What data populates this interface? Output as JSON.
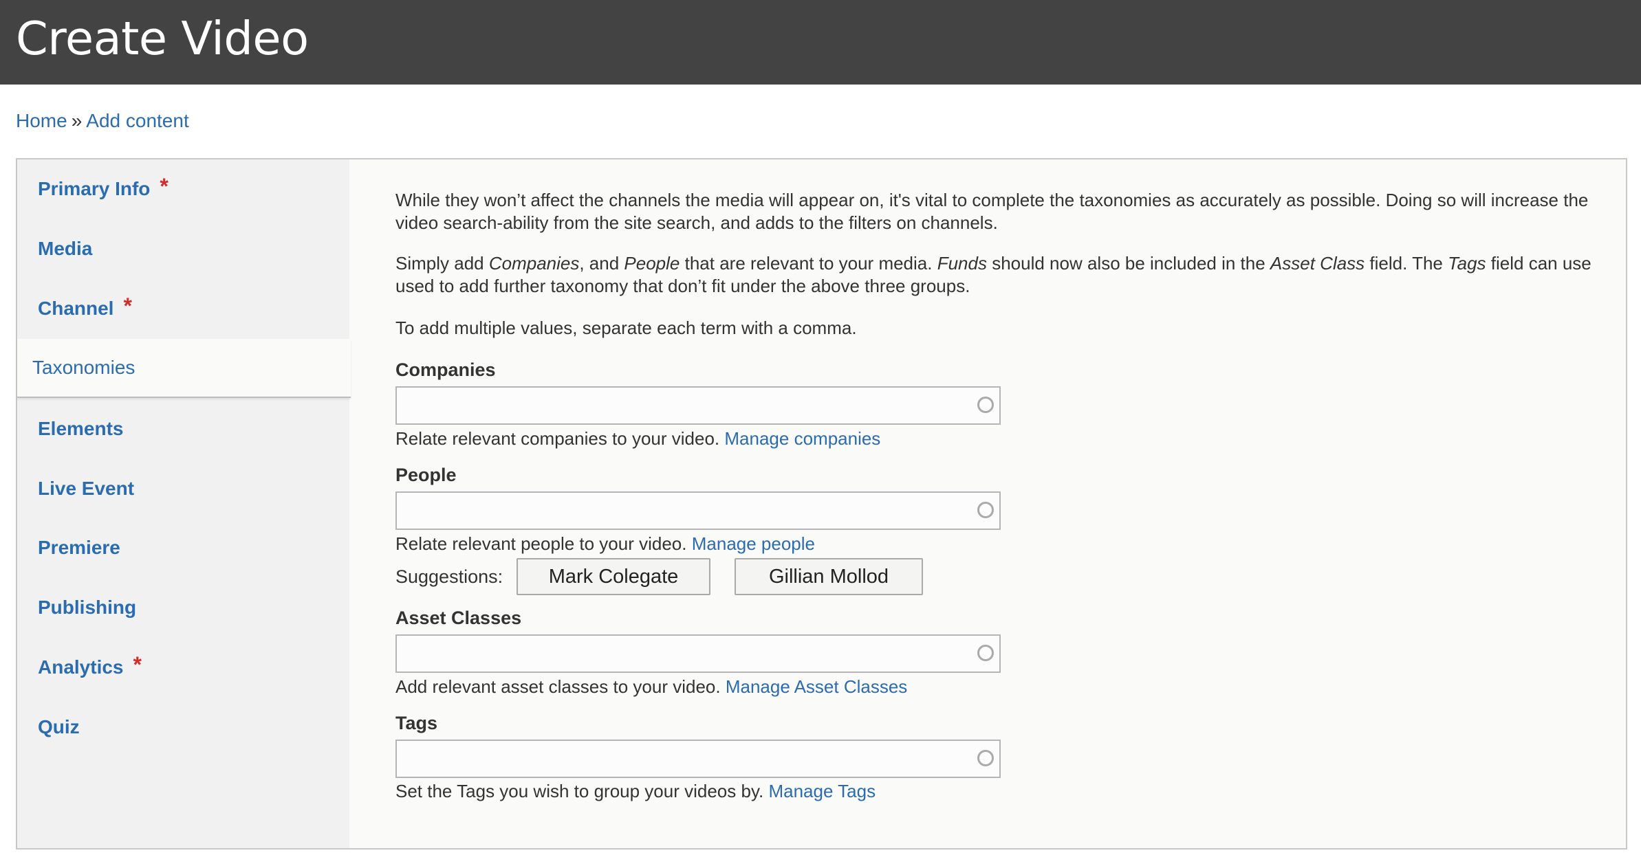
{
  "page": {
    "title": "Create Video"
  },
  "breadcrumb": {
    "home": "Home",
    "separator": "»",
    "current": "Add content"
  },
  "tabs": [
    {
      "label": "Primary Info",
      "required": "*"
    },
    {
      "label": "Media"
    },
    {
      "label": "Channel",
      "required": "*"
    },
    {
      "label": "Taxonomies"
    },
    {
      "label": "Elements"
    },
    {
      "label": "Live Event"
    },
    {
      "label": "Premiere"
    },
    {
      "label": "Publishing"
    },
    {
      "label": "Analytics",
      "required": "*"
    },
    {
      "label": "Quiz"
    }
  ],
  "intro": {
    "p1": "While they won’t affect the channels the media will appear on, it's vital to complete the taxonomies as accurately as possible. Doing so will increase the video search-ability from the site search, and adds to the filters on channels.",
    "p2_parts": [
      "Simply add ",
      "Companies",
      ", and ",
      "People",
      " that are relevant to your media. ",
      "Funds",
      " should now also be included in the ",
      "Asset Class",
      " field. The ",
      "Tags",
      " field can use used to add further taxonomy that don’t fit under the above three groups."
    ],
    "p3": "To add multiple values, separate each term with a comma."
  },
  "fields": {
    "companies": {
      "label": "Companies",
      "value": "",
      "desc": "Relate relevant companies to your video.",
      "link": "Manage companies"
    },
    "people": {
      "label": "People",
      "value": "",
      "desc": "Relate relevant people to your video.",
      "link": "Manage people"
    },
    "asset_classes": {
      "label": "Asset Classes",
      "value": "",
      "desc": "Add relevant asset classes to your video.",
      "link": "Manage Asset Classes"
    },
    "tags": {
      "label": "Tags",
      "value": "",
      "desc": "Set the Tags you wish to group your videos by.",
      "link": "Manage Tags"
    }
  },
  "suggestions": {
    "label": "Suggestions:",
    "items": [
      "Mark Colegate",
      "Gillian Mollod"
    ]
  },
  "colors": {
    "header_bg": "#434343",
    "link": "#2b6cb0",
    "required": "#d62b2b"
  }
}
